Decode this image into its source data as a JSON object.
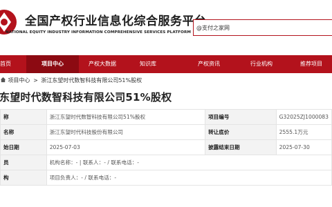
{
  "header": {
    "title": "全国产权行业信息化综合服务平台",
    "subtitle": "NATIONAL EQUITY INDUSTRY INFORMATION COMPREHENSIVE SERVICES PLATFORM",
    "search_value": "@支付之家网"
  },
  "nav": [
    {
      "label": "首页",
      "active": false
    },
    {
      "label": "项目中心",
      "active": true
    },
    {
      "label": "产权大数据",
      "active": false
    },
    {
      "label": "知识库",
      "active": false
    },
    {
      "label": "产权资讯",
      "active": false
    },
    {
      "label": "行业机构",
      "active": false
    },
    {
      "label": "推荐项目",
      "active": false
    }
  ],
  "breadcrumb": {
    "items": [
      "项目中心",
      "浙江东望时代数智科技有限公司51%股权"
    ],
    "separator": ">"
  },
  "page_title": "东望时代数智科技有限公司51%股权",
  "table": {
    "rows": [
      {
        "k1": "称",
        "v1": "浙江东望时代数智科技有限公司51%股权",
        "k2": "项目编号",
        "v2": "G32025ZJ1000083"
      },
      {
        "k1": "名称",
        "v1": "浙江东望时代科技股份有限公司",
        "k2": "转让底价",
        "v2": "2555.1万元"
      },
      {
        "k1": "始日期",
        "v1": "2025-07-03",
        "k2": "披露结束日期",
        "v2": "2025-07-30"
      },
      {
        "k1": "员",
        "v1": "机构名称：- | 联系人：- / 联系电话：-",
        "k2": "",
        "v2": ""
      },
      {
        "k1": "构",
        "v1": "项目负责人：- / 联系电话：-",
        "k2": "",
        "v2": ""
      }
    ]
  },
  "colors": {
    "brand": "#b3121c",
    "nav_active": "#8c0a12"
  },
  "icons": {
    "logo": "logo-icon",
    "home": "home-icon"
  }
}
